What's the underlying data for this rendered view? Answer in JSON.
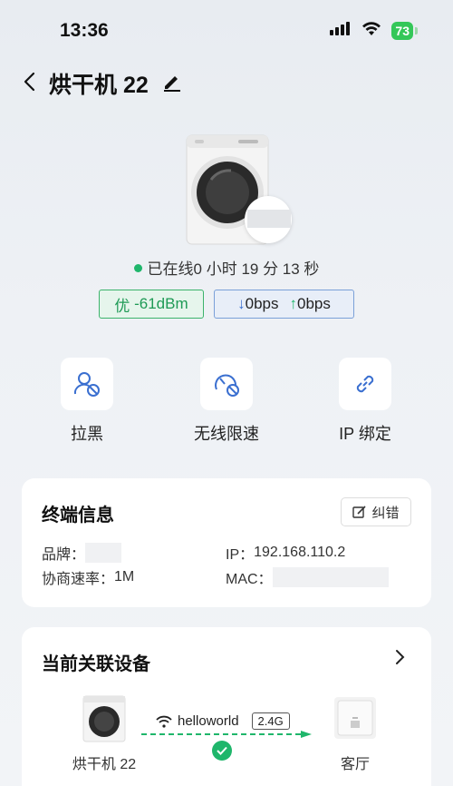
{
  "status_bar": {
    "time": "13:36",
    "battery": "73"
  },
  "header": {
    "title": "烘干机 22"
  },
  "device": {
    "online_prefix": "已在线",
    "online_duration": "0 小时 19 分 13 秒"
  },
  "signal": {
    "quality": "优",
    "rssi": "-61dBm"
  },
  "speed": {
    "down": "0bps",
    "up": "0bps"
  },
  "actions": [
    {
      "label": "拉黑",
      "icon": "block-user-icon"
    },
    {
      "label": "无线限速",
      "icon": "speed-limit-icon"
    },
    {
      "label": "IP 绑定",
      "icon": "link-icon"
    }
  ],
  "terminal_info": {
    "title": "终端信息",
    "correct_label": "纠错",
    "brand_label": "品牌：",
    "rate_label": "协商速率：",
    "rate_value": "1M",
    "ip_label": "IP：",
    "ip_value": "192.168.110.2",
    "mac_label": "MAC："
  },
  "associated": {
    "title": "当前关联设备",
    "device_label": "烘干机 22",
    "ssid": "helloworld",
    "band": "2.4G",
    "ap_label": "客厅"
  },
  "colors": {
    "online_green": "#1fb66b",
    "signal_green": "#1e9a55",
    "accent_blue": "#3a6fd0"
  }
}
